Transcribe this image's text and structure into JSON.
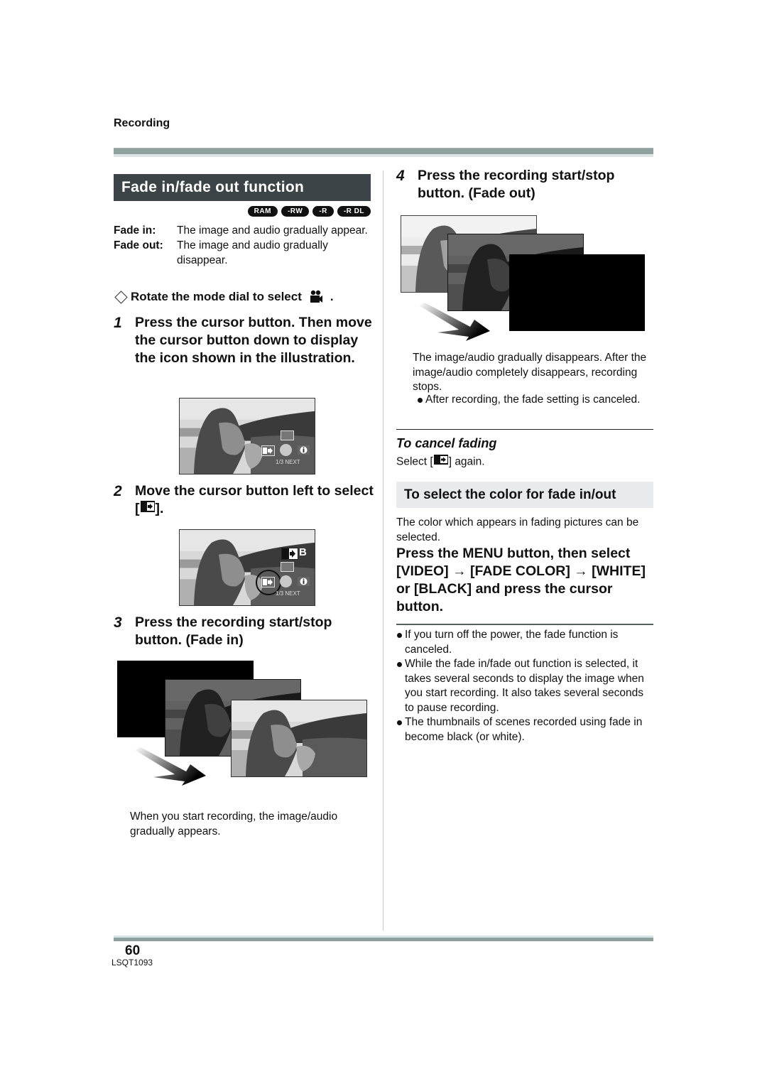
{
  "header": {
    "section": "Recording"
  },
  "title": "Fade in/fade out function",
  "media_badges": [
    "RAM",
    "-RW",
    "-R",
    "-R DL"
  ],
  "definitions": [
    {
      "term": "Fade in:",
      "desc": "The image and audio gradually appear."
    },
    {
      "term": "Fade out:",
      "desc": "The image and audio gradually disappear."
    }
  ],
  "precondition": {
    "text": "Rotate the mode dial to select",
    "icon": "motion-picture-mode-icon",
    "end": "."
  },
  "steps": [
    {
      "num": "1",
      "text": "Press the cursor button. Then move the cursor button down to display the icon shown in the illustration."
    },
    {
      "num": "2",
      "text_before": "Move the cursor button left to select [",
      "icon": "fade-icon",
      "text_after": "]."
    },
    {
      "num": "3",
      "text": "Press the recording start/stop button. (Fade in)"
    },
    {
      "num": "4",
      "text": "Press the recording start/stop button. (Fade out)"
    }
  ],
  "screen_overlay": {
    "page_indicator": "1/3 NEXT",
    "fade_status": "B"
  },
  "fade_in_caption": "When you start recording, the image/audio gradually appears.",
  "fade_out_caption": "The image/audio gradually disappears. After the image/audio completely disappears, recording stops.",
  "fade_out_note": "After recording, the fade setting is canceled.",
  "cancel": {
    "heading": "To cancel fading",
    "text_before": "Select [",
    "icon": "fade-icon",
    "text_after": "] again."
  },
  "color_section": {
    "heading": "To select the color for fade in/out",
    "intro": "The color which appears in fading pictures can be selected.",
    "instruction": "Press the MENU button, then select [VIDEO] → [FADE COLOR] → [WHITE] or [BLACK] and press the cursor button.",
    "notes": [
      "If you turn off the power, the fade function is canceled.",
      "While the fade in/fade out function is selected, it takes several seconds to display the image when you start recording. It also takes several seconds to pause recording.",
      "The thumbnails of scenes recorded using fade in become black (or white)."
    ]
  },
  "footer": {
    "page_number": "60",
    "doc_code": "LSQT1093"
  }
}
